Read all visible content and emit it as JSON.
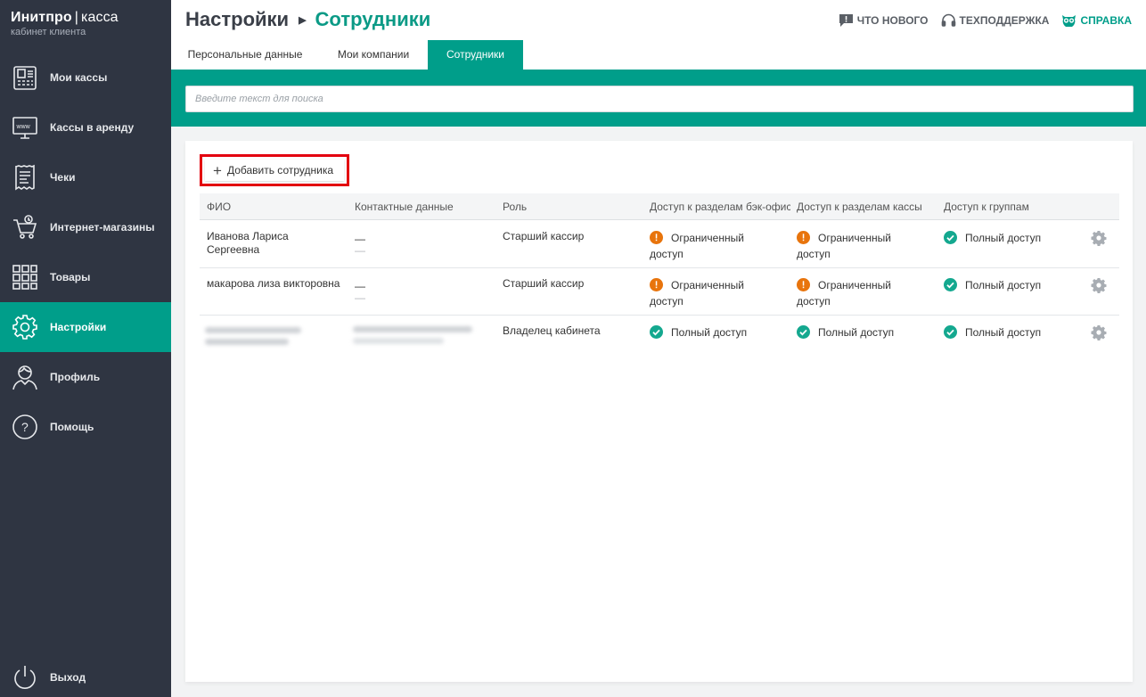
{
  "brand": {
    "name": "Инитпро",
    "separator": "|",
    "product": "касса",
    "subtitle": "кабинет клиента"
  },
  "sidebar": {
    "items": [
      {
        "label": "Мои кассы",
        "icon": "cash-register-icon"
      },
      {
        "label": "Кассы в аренду",
        "icon": "rental-www-icon"
      },
      {
        "label": "Чеки",
        "icon": "receipt-icon"
      },
      {
        "label": "Интернет-магазины",
        "icon": "web-shop-cart-icon"
      },
      {
        "label": "Товары",
        "icon": "products-grid-icon"
      },
      {
        "label": "Настройки",
        "icon": "settings-gear-icon",
        "active": true
      },
      {
        "label": "Профиль",
        "icon": "profile-user-icon"
      },
      {
        "label": "Помощь",
        "icon": "help-question-icon"
      }
    ],
    "logout_label": "Выход"
  },
  "header": {
    "breadcrumb_root": "Настройки",
    "breadcrumb_current": "Сотрудники",
    "links": {
      "whats_new": "ЧТО НОВОГО",
      "support": "ТЕХПОДДЕРЖКА",
      "help": "СПРАВКА"
    }
  },
  "tabs": [
    {
      "label": "Персональные данные"
    },
    {
      "label": "Мои компании"
    },
    {
      "label": "Сотрудники",
      "active": true
    }
  ],
  "search": {
    "placeholder": "Введите текст для поиска",
    "value": ""
  },
  "employees": {
    "add_button": "Добавить сотрудника",
    "columns": [
      "ФИО",
      "Контактные данные",
      "Роль",
      "Доступ к разделам бэк-офиса",
      "Доступ к разделам кассы",
      "Доступ к группам"
    ],
    "rows": [
      {
        "name": "Иванова Лариса Сергеевна",
        "contact_line1": "—",
        "contact_line2": "—",
        "role": "Старший кассир",
        "backoffice": "Ограниченный доступ",
        "backoffice_status": "limited",
        "cashbox": "Ограниченный доступ",
        "cashbox_status": "limited",
        "groups": "Полный доступ",
        "groups_status": "full"
      },
      {
        "name": "макарова лиза викторовна",
        "contact_line1": "—",
        "contact_line2": "—",
        "role": "Старший кассир",
        "backoffice": "Ограниченный доступ",
        "backoffice_status": "limited",
        "cashbox": "Ограниченный доступ",
        "cashbox_status": "limited",
        "groups": "Полный доступ",
        "groups_status": "full"
      },
      {
        "name": "",
        "name_blurred": true,
        "contact_blurred": true,
        "role": "Владелец кабинета",
        "backoffice": "Полный доступ",
        "backoffice_status": "full",
        "cashbox": "Полный доступ",
        "cashbox_status": "full",
        "groups": "Полный доступ",
        "groups_status": "full"
      }
    ]
  },
  "colors": {
    "accent": "#009e8a",
    "sidebar_bg": "#2f3542",
    "warning": "#e8740c",
    "success": "#14a88f",
    "highlight_border": "#e3000f"
  }
}
